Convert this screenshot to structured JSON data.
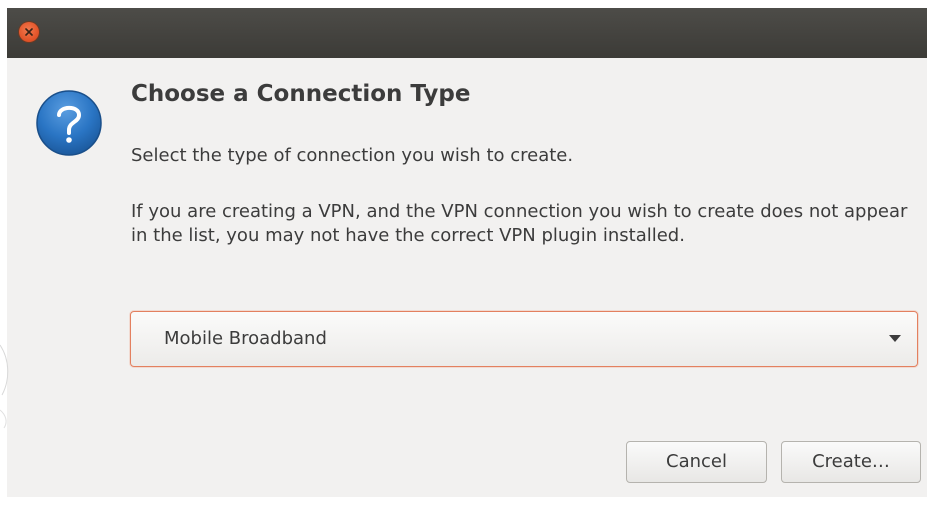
{
  "window": {
    "close_icon": "close-icon"
  },
  "dialog": {
    "icon": "question-icon",
    "heading": "Choose a Connection Type",
    "subtitle": "Select the type of connection you wish to create.",
    "vpn_note": "If you are creating a VPN, and the VPN connection you wish to create does not appear in the list, you may not have the correct VPN plugin installed.",
    "connection_type": {
      "selected": "Mobile Broadband"
    },
    "buttons": {
      "cancel": "Cancel",
      "create": "Create…"
    }
  },
  "colors": {
    "titlebar": "#3c3b37",
    "close_button": "#e4552a",
    "focus_border": "#e3805f",
    "dialog_bg": "#f2f1f0",
    "question_icon": "#2a75c4"
  }
}
